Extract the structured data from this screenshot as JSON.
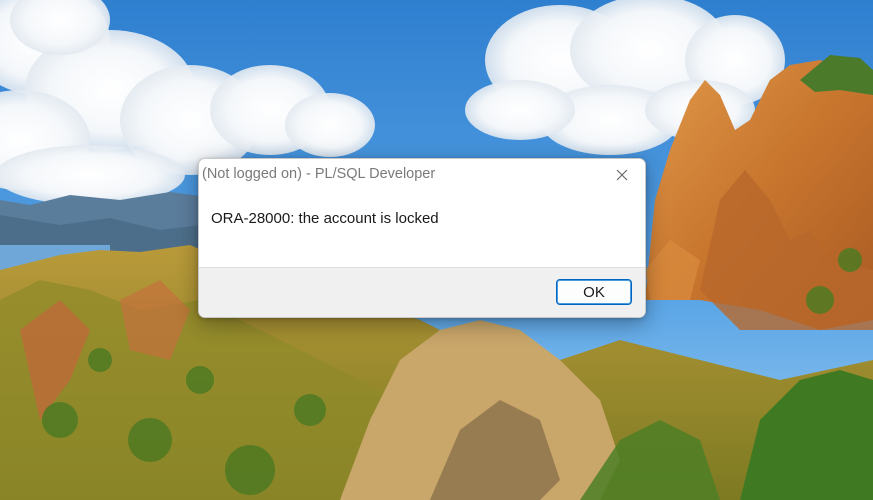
{
  "dialog": {
    "title": "(Not logged on) - PL/SQL Developer",
    "message": "ORA-28000: the account is locked",
    "ok_label": "OK",
    "close_icon": "close-icon"
  },
  "colors": {
    "accent": "#0067c0",
    "title_text": "#7a7a7a",
    "footer_bg": "#f0f0f0"
  }
}
